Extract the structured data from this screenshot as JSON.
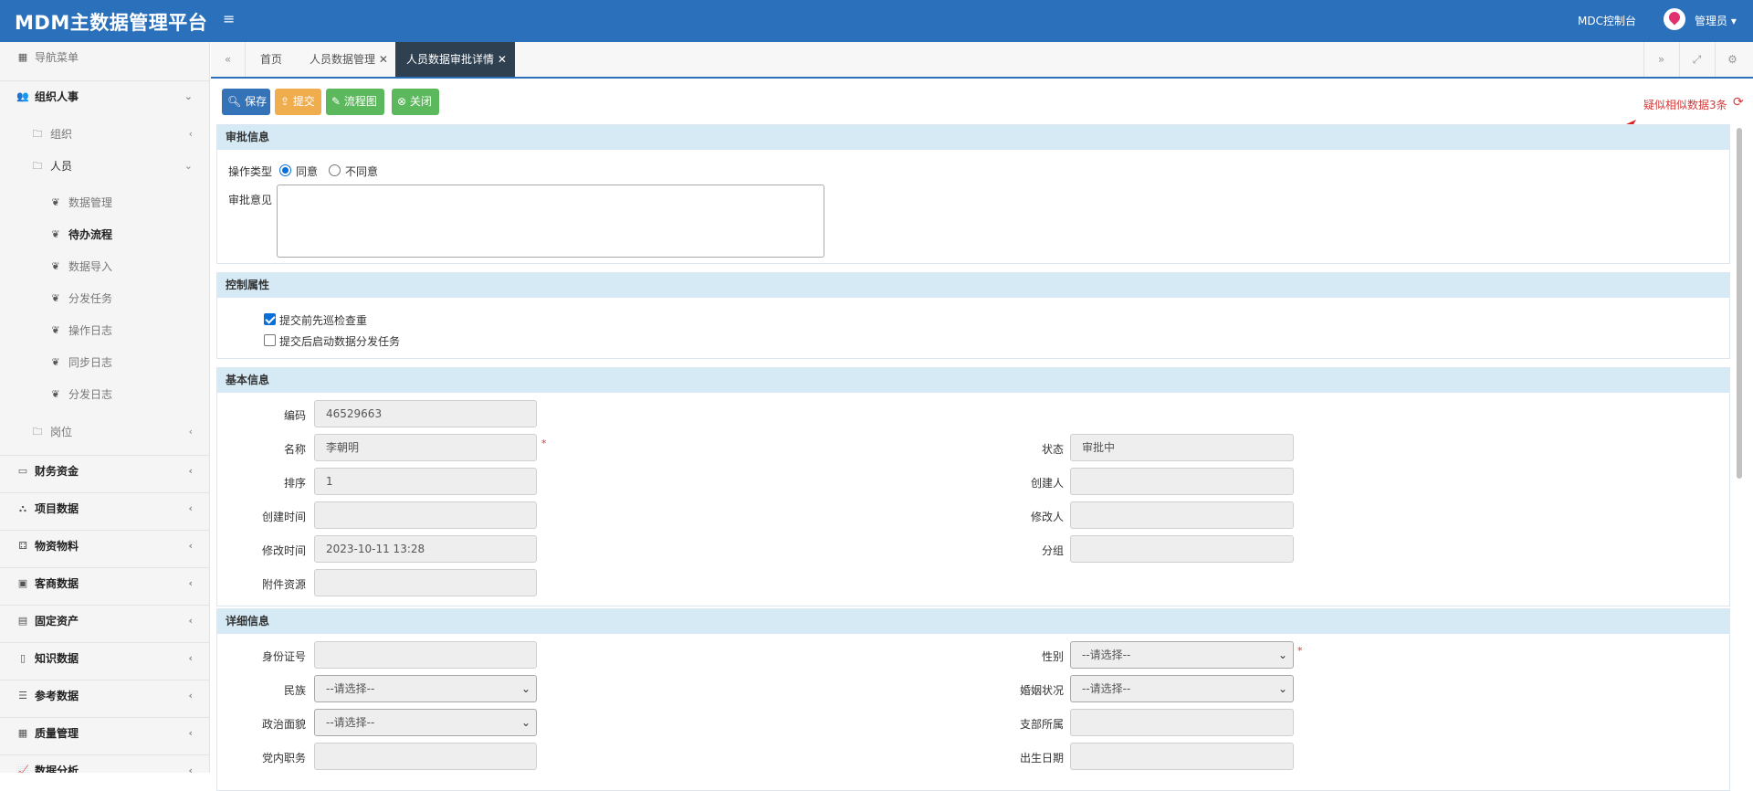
{
  "header": {
    "brand": "MDM主数据管理平台",
    "console_link": "MDC控制台",
    "user_menu": "管理员 ▾",
    "menu_toggle_icon": "bars-icon",
    "avatar_icon": "map-pin-icon",
    "color": "#2a70bb"
  },
  "sidebar": {
    "nav_title": "导航菜单",
    "items": [
      {
        "label": "组织人事",
        "icon": "users-icon"
      },
      {
        "label": "组织",
        "icon": "folder-icon"
      },
      {
        "label": "人员",
        "icon": "folder-icon"
      },
      {
        "label": "数据管理",
        "icon": "leaf-icon"
      },
      {
        "label": "待办流程",
        "icon": "leaf-icon"
      },
      {
        "label": "数据导入",
        "icon": "leaf-icon"
      },
      {
        "label": "分发任务",
        "icon": "leaf-icon"
      },
      {
        "label": "操作日志",
        "icon": "leaf-icon"
      },
      {
        "label": "同步日志",
        "icon": "leaf-icon"
      },
      {
        "label": "分发日志",
        "icon": "leaf-icon"
      },
      {
        "label": "岗位",
        "icon": "folder-icon"
      },
      {
        "label": "财务资金",
        "icon": "credit-card-icon"
      },
      {
        "label": "项目数据",
        "icon": "sitemap-icon"
      },
      {
        "label": "物资物料",
        "icon": "cubes-icon"
      },
      {
        "label": "客商数据",
        "icon": "briefcase-icon"
      },
      {
        "label": "固定资产",
        "icon": "archive-icon"
      },
      {
        "label": "知识数据",
        "icon": "file-icon"
      },
      {
        "label": "参考数据",
        "icon": "list-icon"
      },
      {
        "label": "质量管理",
        "icon": "table-icon"
      },
      {
        "label": "数据分析",
        "icon": "chart-icon"
      }
    ]
  },
  "tabs": {
    "items": [
      "首页",
      "人员数据管理",
      "人员数据审批详情"
    ],
    "active": 2
  },
  "toolbar": {
    "save": "保存",
    "submit": "提交",
    "flow": "流程图",
    "close": "关闭"
  },
  "similar_notice": "疑似相似数据3条",
  "approval": {
    "title": "审批信息",
    "op_type_label": "操作类型",
    "agree": "同意",
    "disagree": "不同意",
    "opinion_label": "审批意见",
    "selected": "同意"
  },
  "control": {
    "title": "控制属性",
    "check1": "提交前先巡检查重",
    "check2": "提交后启动数据分发任务",
    "check1_checked": true,
    "check2_checked": false
  },
  "basic": {
    "title": "基本信息",
    "code_label": "编码",
    "code": "46529663",
    "name_label": "名称",
    "name": "李朝明",
    "status_label": "状态",
    "status": "审批中",
    "order_label": "排序",
    "order": "1",
    "creator_label": "创建人",
    "creator": "",
    "create_time_label": "创建时间",
    "create_time": "",
    "modifier_label": "修改人",
    "modifier": "",
    "modify_time_label": "修改时间",
    "modify_time": "2023-10-11 13:28",
    "group_label": "分组",
    "group": "",
    "attach_label": "附件资源",
    "attach": ""
  },
  "detail": {
    "title": "详细信息",
    "idcard_label": "身份证号",
    "idcard": "",
    "gender_label": "性别",
    "gender": "--请选择--",
    "nation_label": "民族",
    "nation": "--请选择--",
    "marital_label": "婚姻状况",
    "marital": "--请选择--",
    "political_label": "政治面貌",
    "political": "--请选择--",
    "branch_label": "支部所属",
    "branch": "",
    "party_post_label": "党内职务",
    "party_post": "",
    "birth_label": "出生日期",
    "birth": ""
  }
}
